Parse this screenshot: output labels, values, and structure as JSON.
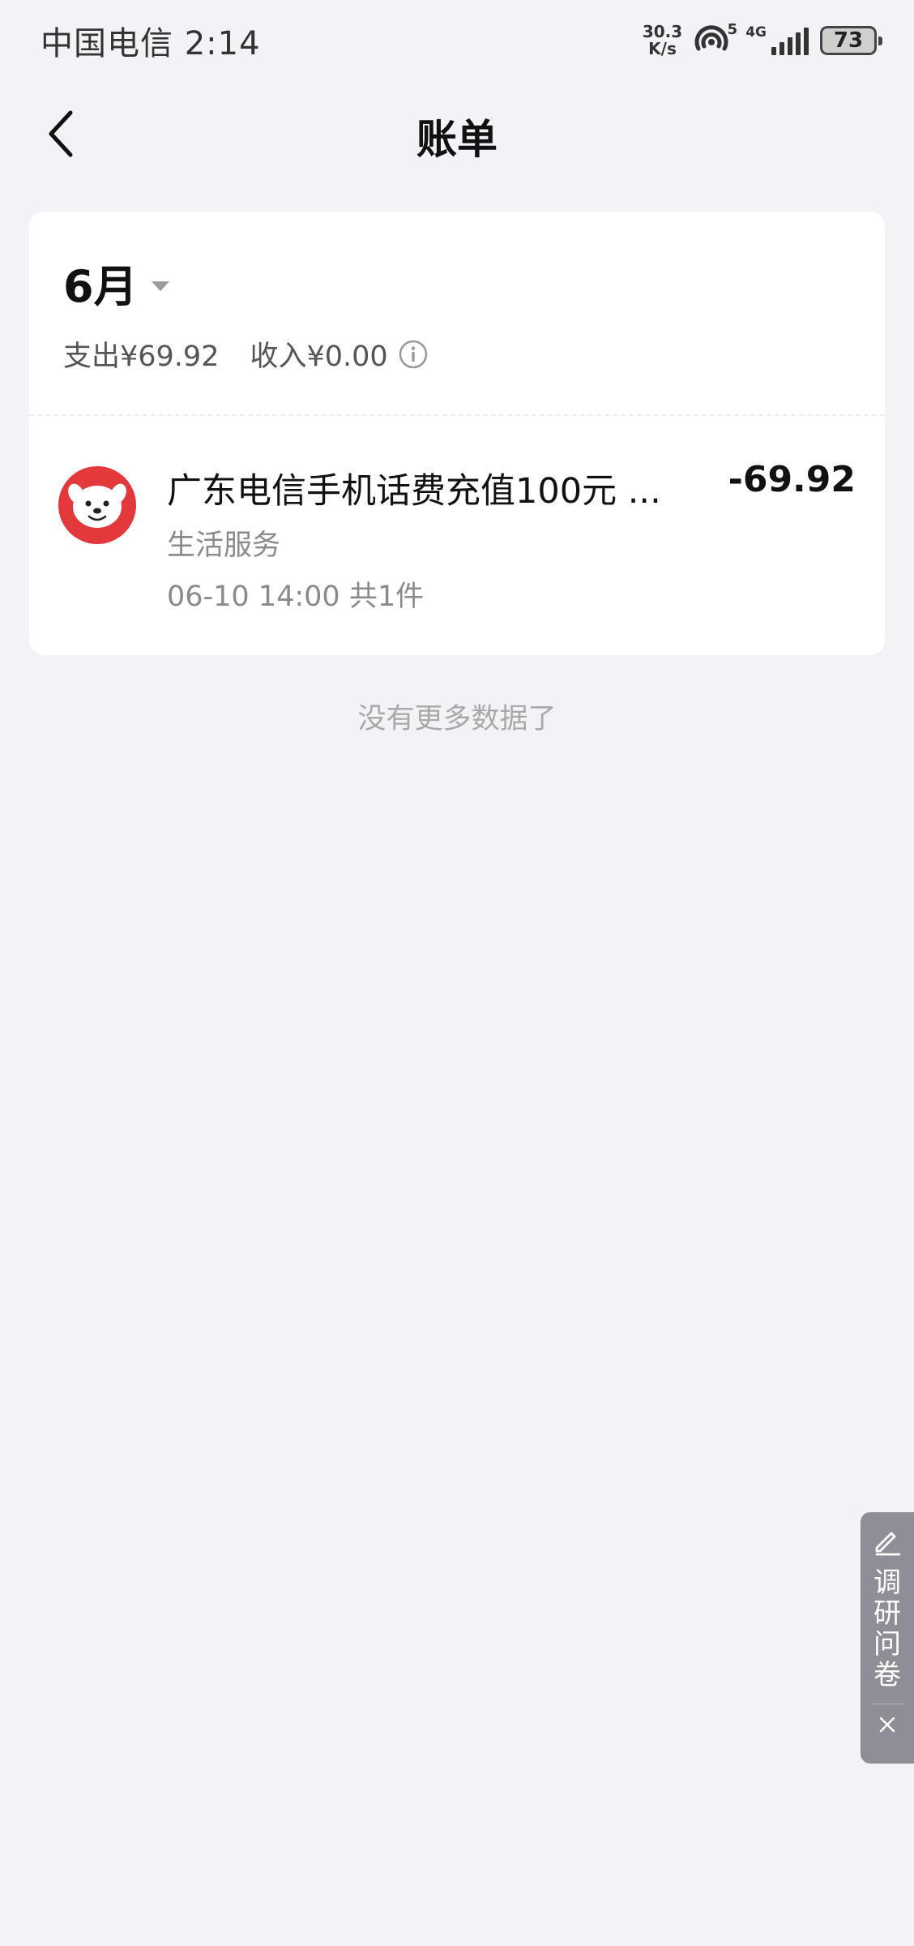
{
  "status_bar": {
    "carrier": "中国电信",
    "time": "2:14",
    "net_speed_value": "30.3",
    "net_speed_unit": "K/s",
    "hotspot_count": "5",
    "network_type": "4G",
    "battery": "73"
  },
  "nav": {
    "title": "账单",
    "back_icon": "chevron-left-icon"
  },
  "summary": {
    "month": "6月",
    "expense": "支出¥69.92",
    "income": "收入¥0.00"
  },
  "bills": [
    {
      "title": "广东电信手机话费充值100元 ...",
      "category": "生活服务",
      "datetime": "06-10 14:00",
      "count": "共1件",
      "amount": "-69.92",
      "avatar_icon": "jd-mascot-icon"
    }
  ],
  "footer": {
    "no_more": "没有更多数据了"
  },
  "survey": {
    "label": "调研问卷",
    "open_icon": "pencil-icon",
    "close_icon": "close-icon"
  },
  "colors": {
    "background": "#f2f2f7",
    "card": "#ffffff",
    "brand_red": "#e4393c",
    "muted_text": "#8a8a8a",
    "survey_tab": "#8e8e96"
  }
}
